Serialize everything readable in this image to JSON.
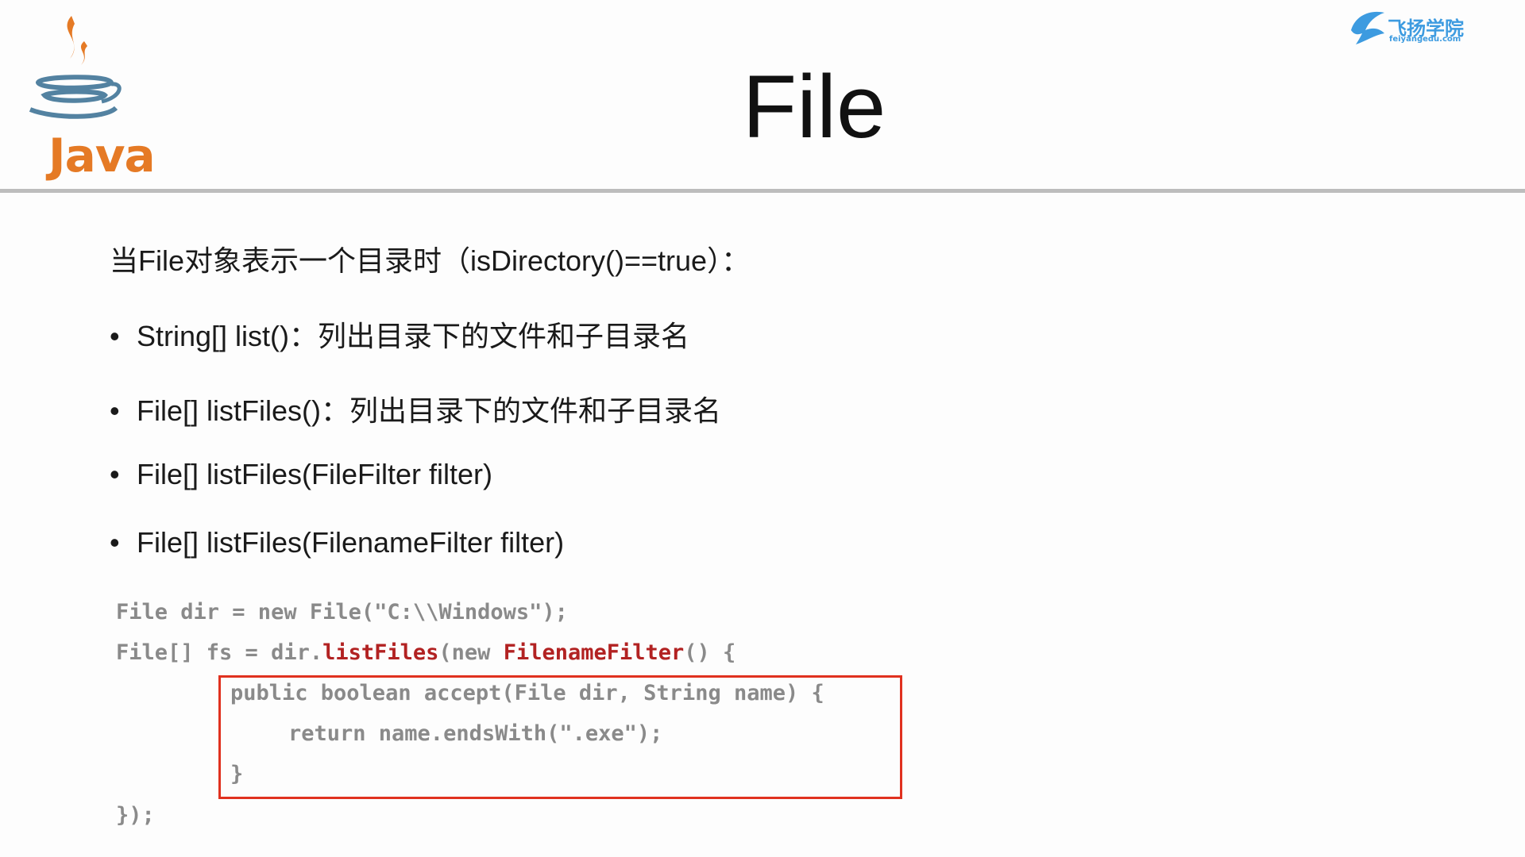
{
  "logo": {
    "wordmark": "Java"
  },
  "brand": {
    "name": "飞扬学院",
    "domain": "feiyangedu.com"
  },
  "title": "File",
  "intro": "当File对象表示一个目录时（isDirectory()==true）：",
  "bullets": [
    {
      "bullet": "•",
      "text": "String[] list()：列出目录下的文件和子目录名"
    },
    {
      "bullet": "•",
      "text": "File[] listFiles()：列出目录下的文件和子目录名"
    },
    {
      "bullet": "•",
      "text": "File[] listFiles(FileFilter filter)"
    },
    {
      "bullet": "•",
      "text": "File[] listFiles(FilenameFilter filter)"
    }
  ],
  "code": {
    "line1": "File dir = new File(\"C:\\\\Windows\");",
    "line2_a": "File[] fs = dir.",
    "line2_method": "listFiles",
    "line2_b": "(new ",
    "line2_class": "FilenameFilter",
    "line2_c": "() {",
    "line3": "public boolean accept(File dir, String name) {",
    "line4": "return name.endsWith(\".exe\");",
    "line5": "}",
    "line6": "});"
  },
  "colors": {
    "java_orange": "#e57a25",
    "java_blue": "#5382a1",
    "brand_blue": "#3d9be0",
    "code_highlight": "#b22222",
    "box_border": "#e0311f"
  }
}
